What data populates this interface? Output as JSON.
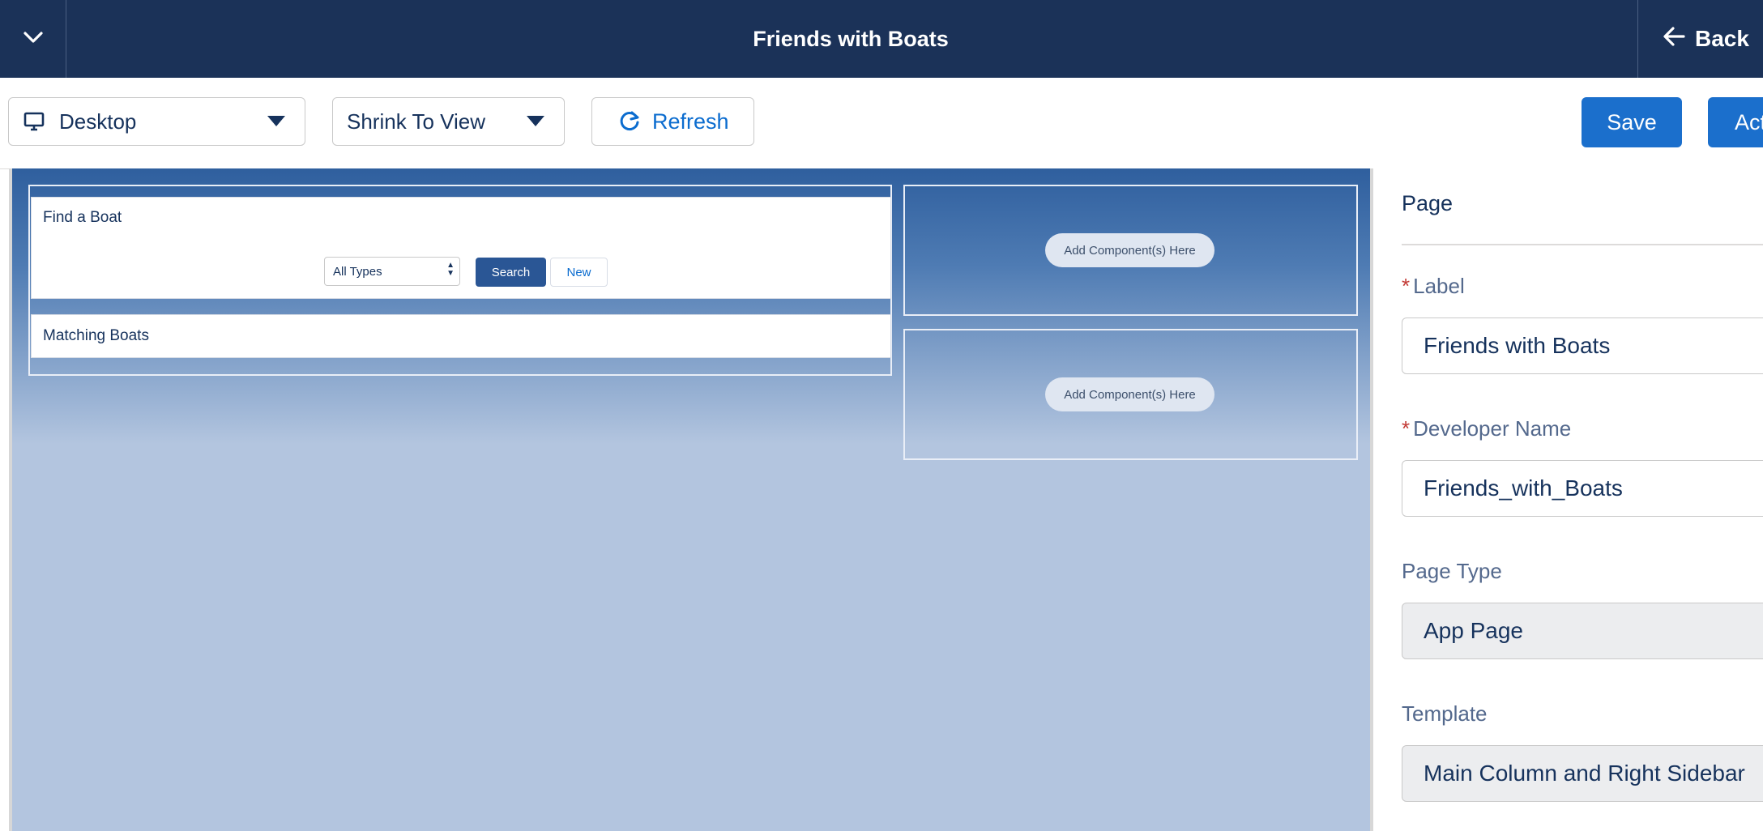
{
  "header": {
    "title": "Friends with Boats",
    "back_label": "Back"
  },
  "toolbar": {
    "device_value": "Desktop",
    "zoom_value": "Shrink To View",
    "refresh_label": "Refresh",
    "save_label": "Save",
    "actions_label": "Act"
  },
  "canvas": {
    "find_card": {
      "title": "Find a Boat",
      "type_select_value": "All Types",
      "search_label": "Search",
      "new_label": "New"
    },
    "matching_card": {
      "title": "Matching Boats"
    },
    "add_component_label": "Add Component(s) Here"
  },
  "panel": {
    "heading": "Page",
    "label_field": {
      "label": "Label",
      "value": "Friends with Boats"
    },
    "developer_name_field": {
      "label": "Developer Name",
      "value": "Friends_with_Boats"
    },
    "page_type_field": {
      "label": "Page Type",
      "value": "App Page"
    },
    "template_field": {
      "label": "Template",
      "value": "Main Column and Right Sidebar"
    }
  },
  "colors": {
    "header_bg": "#1b3258",
    "brand_blue": "#1b6fcc",
    "required": "#c23934"
  }
}
